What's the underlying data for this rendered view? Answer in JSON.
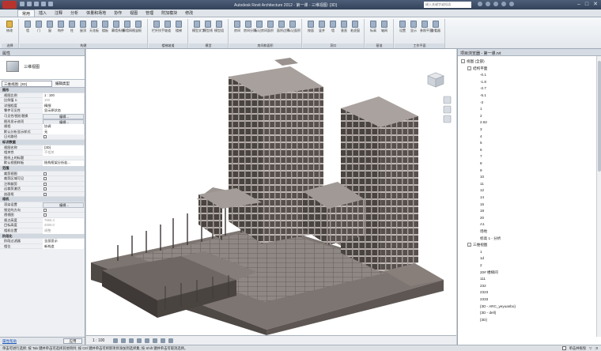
{
  "titlebar": {
    "title": "Autodesk Revit Architecture 2012 - 第一课 - 三维视图: {3D}",
    "search_placeholder": "键入关键字或短语"
  },
  "menu_tabs": [
    "常用",
    "插入",
    "注释",
    "分析",
    "体量和场地",
    "协作",
    "视图",
    "管理",
    "附加模块",
    "修改"
  ],
  "ribbon": {
    "groups": [
      {
        "label": "选择",
        "buttons": [
          "修改"
        ]
      },
      {
        "label": "构建",
        "buttons": [
          "墙",
          "门",
          "窗",
          "构件",
          "柱",
          "屋顶",
          "天花板",
          "楼板",
          "幕墙系统",
          "幕墙网格",
          "竖梃"
        ]
      },
      {
        "label": "楼梯坡道",
        "buttons": [
          "栏杆扶手",
          "坡道",
          "楼梯"
        ]
      },
      {
        "label": "模型",
        "buttons": [
          "模型文字",
          "模型线",
          "模型组"
        ]
      },
      {
        "label": "房间和面积",
        "buttons": [
          "房间",
          "房间分隔",
          "标记房间",
          "面积",
          "面积边界",
          "标记面积"
        ]
      },
      {
        "label": "洞口",
        "buttons": [
          "按面",
          "竖井",
          "墙",
          "垂直",
          "老虎窗"
        ]
      },
      {
        "label": "基准",
        "buttons": [
          "标高",
          "轴网"
        ]
      },
      {
        "label": "工作平面",
        "buttons": [
          "设置",
          "显示",
          "参照平面",
          "查看器"
        ]
      }
    ]
  },
  "properties": {
    "panel_title": "属性",
    "type_name": "三维视图",
    "filter_value": "三维视图: {3D}",
    "edit_type": "编辑类型",
    "rows": [
      {
        "cat": "图形"
      },
      {
        "key": "视图比例",
        "val": "1 : 100"
      },
      {
        "key": "比例值 1:",
        "val": "100",
        "gray": true
      },
      {
        "key": "详细程度",
        "val": "精细"
      },
      {
        "key": "零件可见性",
        "val": "显示原状态"
      },
      {
        "key": "可见性/图形替换",
        "val": "编辑...",
        "btn": true
      },
      {
        "key": "图形显示选项",
        "val": "编辑...",
        "btn": true
      },
      {
        "key": "规程",
        "val": "协调"
      },
      {
        "key": "默认分析显示样式",
        "val": "无"
      },
      {
        "key": "日光路径",
        "check": true
      },
      {
        "cat": "标识数据"
      },
      {
        "key": "视图名称",
        "val": "{3D}"
      },
      {
        "key": "相关性",
        "val": "不相关",
        "gray": true
      },
      {
        "key": "图纸上的标题",
        "val": ""
      },
      {
        "key": "默认视图样板",
        "val": "结构框架分析若..."
      },
      {
        "cat": "范围"
      },
      {
        "key": "裁剪视图",
        "check": true
      },
      {
        "key": "裁剪区域可见",
        "check": true
      },
      {
        "key": "注释裁剪",
        "check": true
      },
      {
        "key": "远裁剪激活",
        "check": true
      },
      {
        "key": "剖面框",
        "check": true
      },
      {
        "cat": "相机"
      },
      {
        "key": "渲染设置",
        "val": "编辑...",
        "btn": true
      },
      {
        "key": "锁定的方向",
        "check": true
      },
      {
        "key": "透视图",
        "check": true
      },
      {
        "key": "视点高度",
        "val": "7660.4",
        "gray": true
      },
      {
        "key": "目标高度",
        "val": "2000.0",
        "gray": true
      },
      {
        "key": "相机位置",
        "val": "调整",
        "gray": true
      },
      {
        "cat": "阶段化"
      },
      {
        "key": "阶段过滤器",
        "val": "全部显示"
      },
      {
        "key": "相位",
        "val": "新构造"
      }
    ],
    "help_link": "属性帮助",
    "apply_label": "应用"
  },
  "view": {
    "scale": "1 : 100"
  },
  "browser": {
    "title": "项目浏览器 - 第一课.rvt",
    "root": "视图 (全部)",
    "group1": "结构平面",
    "levels": [
      "-0.1",
      "-1.8",
      "-2.7",
      "-5.1",
      "-3",
      "1",
      "2",
      "2.62",
      "3",
      "4",
      "5",
      "6",
      "7",
      "8",
      "9",
      "10",
      "11",
      "12",
      "14",
      "16",
      "18",
      "20",
      "A1",
      "场地",
      "标高 1 - 分析"
    ],
    "group2": "三维视图",
    "views3d": [
      "1",
      "1d",
      "2",
      "20# 楼梯间",
      "111",
      "232",
      "2323",
      "2333",
      "{3D - ARC_yeyuanbo}",
      "{3D - dell}",
      "{3D}"
    ]
  },
  "statusbar": {
    "text": "单击可进行选择; 按 Tab 键并单击可选择其他项目; 按 Ctrl 键并单击可将新项目添加到选择集; 按 Shift 键并单击可取消选择。",
    "right_label": "单击并拖曳",
    "filter_count": ":0"
  },
  "colors": {
    "model_light": "#b6afab",
    "model_mid": "#8a827e",
    "model_dark": "#5c5552"
  }
}
